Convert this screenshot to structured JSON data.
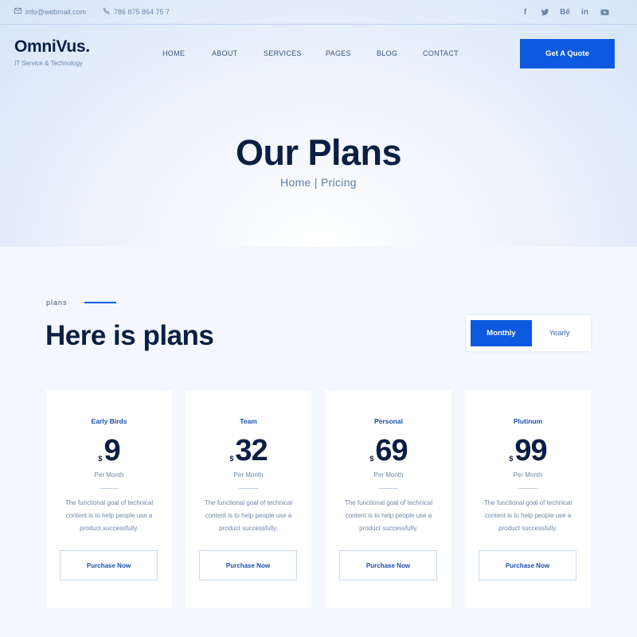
{
  "topbar": {
    "email": "info@webmail.com",
    "phone": "786 875 864 75 7",
    "social": [
      {
        "icon": "facebook-icon",
        "label": "f"
      },
      {
        "icon": "twitter-icon",
        "label": ""
      },
      {
        "icon": "behance-icon",
        "label": "Bē"
      },
      {
        "icon": "linkedin-icon",
        "label": "in"
      },
      {
        "icon": "youtube-icon",
        "label": ""
      }
    ]
  },
  "brand": {
    "logo": "OmniVus.",
    "tagline": "IT Service & Technology"
  },
  "nav": {
    "items": [
      "HOME",
      "ABOUT",
      "SERVICES",
      "PAGES",
      "BLOG",
      "CONTACT"
    ],
    "cta": "Get A Quote"
  },
  "hero": {
    "title": "Our Plans",
    "breadcrumb_home": "Home",
    "breadcrumb_sep": "|",
    "breadcrumb_current": "Pricing"
  },
  "plans_section": {
    "label": "plans",
    "title": "Here is plans",
    "toggle": {
      "active": "Monthly",
      "inactive": "Yearly"
    }
  },
  "plans": [
    {
      "name": "Early Birds",
      "currency": "$",
      "price": "9",
      "period": "Per Month",
      "description": "The functional goal of technical content is to help people use a product successfully.",
      "button": "Purchase Now"
    },
    {
      "name": "Team",
      "currency": "$",
      "price": "32",
      "period": "Per Month",
      "description": "The functional goal of technical content is to help people use a product successfully.",
      "button": "Purchase Now"
    },
    {
      "name": "Personal",
      "currency": "$",
      "price": "69",
      "period": "Per Month",
      "description": "The functional goal of technical content is to help people use a product successfully.",
      "button": "Purchase Now"
    },
    {
      "name": "Plutinum",
      "currency": "$",
      "price": "99",
      "period": "Per Month",
      "description": "The functional goal of technical content is to help people use a product successfully.",
      "button": "Purchase Now"
    }
  ],
  "colors": {
    "accent": "#0d5ae0",
    "dark": "#0b1f44",
    "muted": "#6f87a8"
  }
}
